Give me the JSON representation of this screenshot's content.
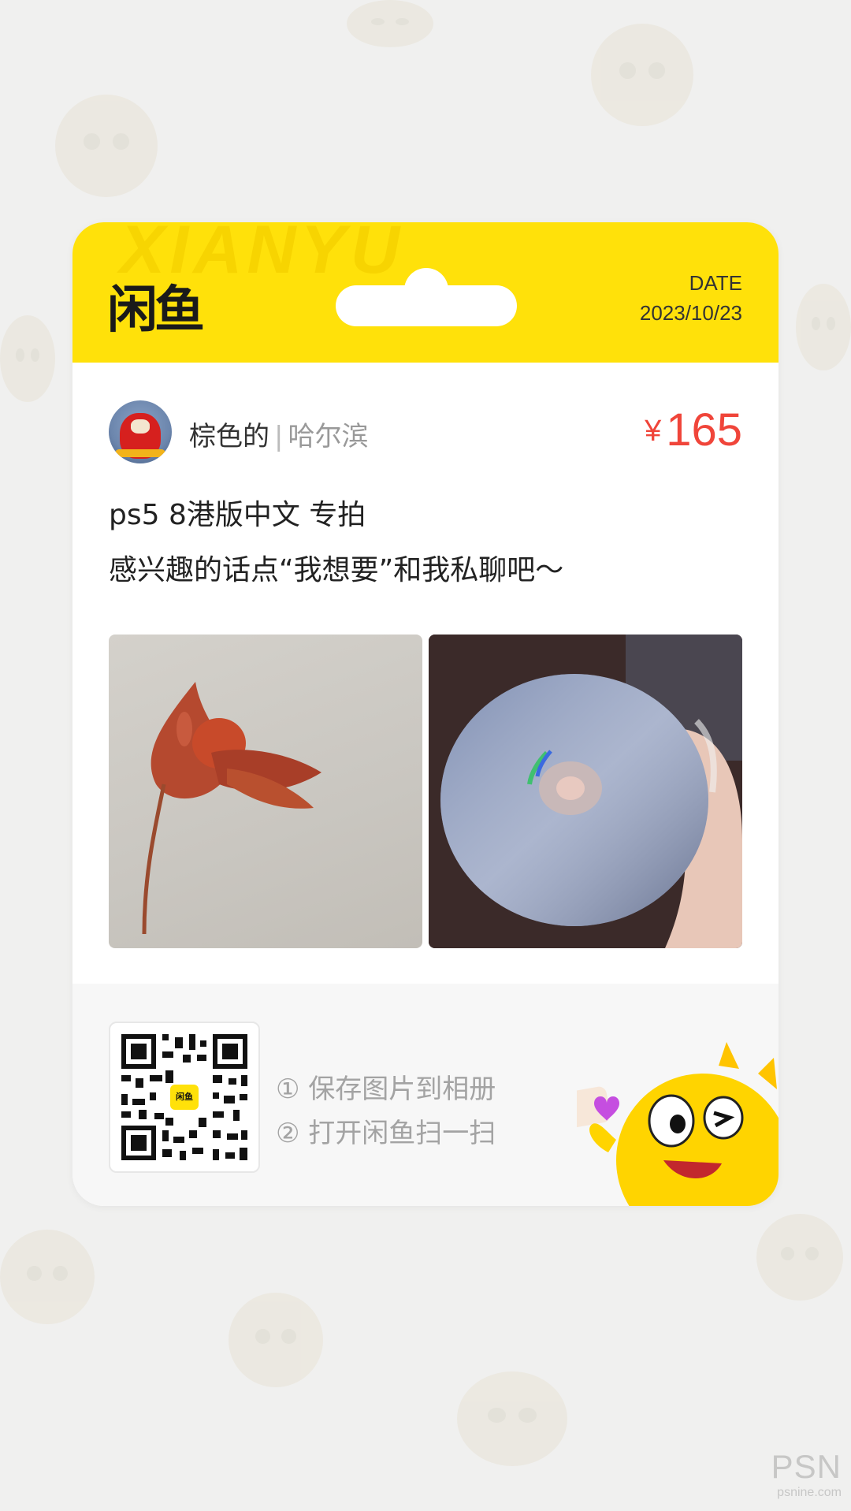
{
  "header": {
    "watermark": "XIANYU",
    "logo": "闲鱼",
    "date_label": "DATE",
    "date_value": "2023/10/23"
  },
  "seller": {
    "name": "棕色的",
    "separator": "|",
    "location": "哈尔滨"
  },
  "price": {
    "currency": "¥",
    "value": "165"
  },
  "description": {
    "line1": "ps5 8港版中文 专拍",
    "line2": "感兴趣的话点“我想要”和我私聊吧～"
  },
  "photos": [
    "photo-flower",
    "photo-disc"
  ],
  "footer": {
    "qr_badge": "闲鱼",
    "step1": "① 保存图片到相册",
    "step2": "② 打开闲鱼扫一扫"
  },
  "watermark": {
    "brand": "PSN",
    "sub": "psnine.com"
  },
  "colors": {
    "brand_yellow": "#ffe10a",
    "price_red": "#f0453a",
    "background": "#f0f0ef"
  }
}
